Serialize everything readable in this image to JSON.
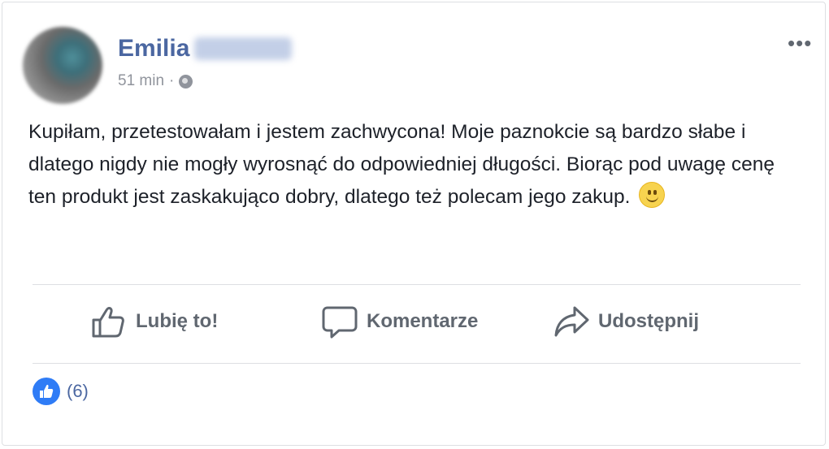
{
  "post": {
    "author_first": "Emilia",
    "time": "51 min",
    "separator": "·",
    "body": "Kupiłam, przetestowałam i jestem zachwycona! Moje paznokcie są bardzo słabe i dlatego nigdy nie mogły wyrosnąć do odpowiedniej długości. Biorąc pod uwagę cenę ten produkt jest zaskakująco dobry, dlatego też polecam jego zakup.",
    "more_label": "•••"
  },
  "actions": {
    "like": "Lubię to!",
    "comment": "Komentarze",
    "share": "Udostępnij"
  },
  "reactions": {
    "count": "(6)"
  },
  "icons": [
    "globe-icon",
    "more-icon",
    "thumbs-up-icon",
    "comment-icon",
    "share-icon",
    "smiley-emoji"
  ],
  "colors": {
    "name": "#4b67a1",
    "muted": "#90949c",
    "action": "#606770",
    "like_badge": "#2f7cf6"
  }
}
